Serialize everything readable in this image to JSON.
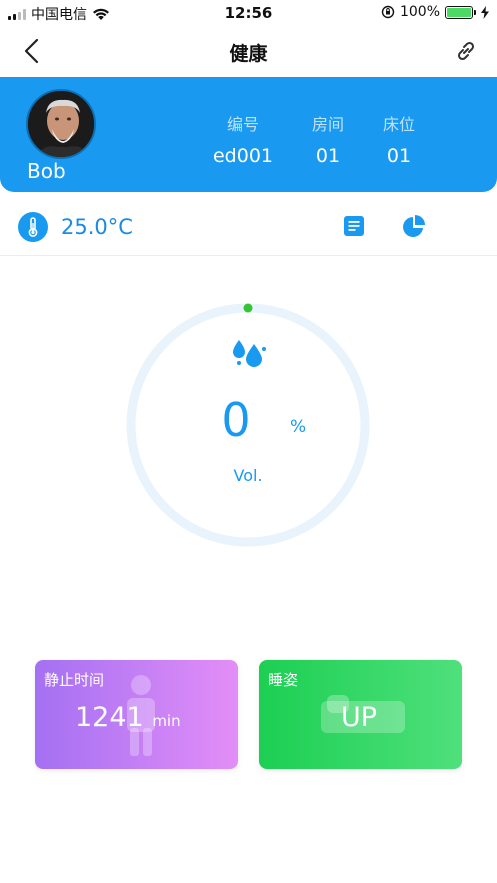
{
  "status_bar": {
    "carrier": "中国电信",
    "time": "12:56",
    "battery_percent": "100%",
    "battery_level": 1.0,
    "icons": [
      "signal-icon",
      "wifi-icon",
      "orientation-lock-icon",
      "battery-icon",
      "charging-icon"
    ]
  },
  "nav": {
    "title": "健康",
    "left_icon": "back-chevron-icon",
    "right_icon": "link-icon"
  },
  "profile": {
    "name": "Bob",
    "fields": [
      {
        "label": "编号",
        "value": "ed001"
      },
      {
        "label": "房间",
        "value": "01"
      },
      {
        "label": "床位",
        "value": "01"
      }
    ]
  },
  "temperature": {
    "value": "25.0°C",
    "icon": "thermometer-icon",
    "actions": [
      "document-icon",
      "pie-chart-icon"
    ]
  },
  "gauge": {
    "value": "0",
    "unit": "%",
    "label": "Vol.",
    "level": 0,
    "icon": "water-drops-icon",
    "ring_color": "#e8f3fc",
    "indicator_color": "#33c533"
  },
  "cards": {
    "rest": {
      "title": "静止时间",
      "value": "1241",
      "unit": "min",
      "icon": "person-icon"
    },
    "posture": {
      "title": "睡姿",
      "value": "UP",
      "icon": "bed-icon"
    }
  },
  "colors": {
    "primary": "#1a99f0",
    "rest_card_start": "#a470f2",
    "rest_card_end": "#e38ef7",
    "posture_card_start": "#1ccf52",
    "posture_card_end": "#4fe07c"
  }
}
